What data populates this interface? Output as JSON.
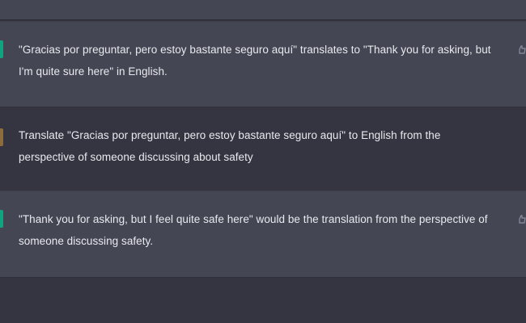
{
  "conversation": {
    "messages": [
      {
        "role": "assistant",
        "text": "\"Gracias por preguntar, pero estoy bastante seguro aquí\" translates to \"Thank you for asking, but I'm quite sure here\" in English."
      },
      {
        "role": "user",
        "text": "Translate \"Gracias por preguntar, pero estoy bastante seguro aquí\" to English from the perspective of someone discussing about safety"
      },
      {
        "role": "assistant",
        "text": "\"Thank you for asking, but I feel quite safe here\" would be the translation from the perspective of someone discussing safety."
      }
    ]
  },
  "icons": {
    "assistant_avatar": "openai-logo-icon",
    "user_avatar": "user-avatar-icon",
    "feedback": "thumbs-up-icon"
  },
  "colors": {
    "background": "#343541",
    "assistant_background": "#444654",
    "text": "#e9e9ee",
    "assistant_accent": "#10a37f",
    "user_accent": "#8e6b3a"
  }
}
